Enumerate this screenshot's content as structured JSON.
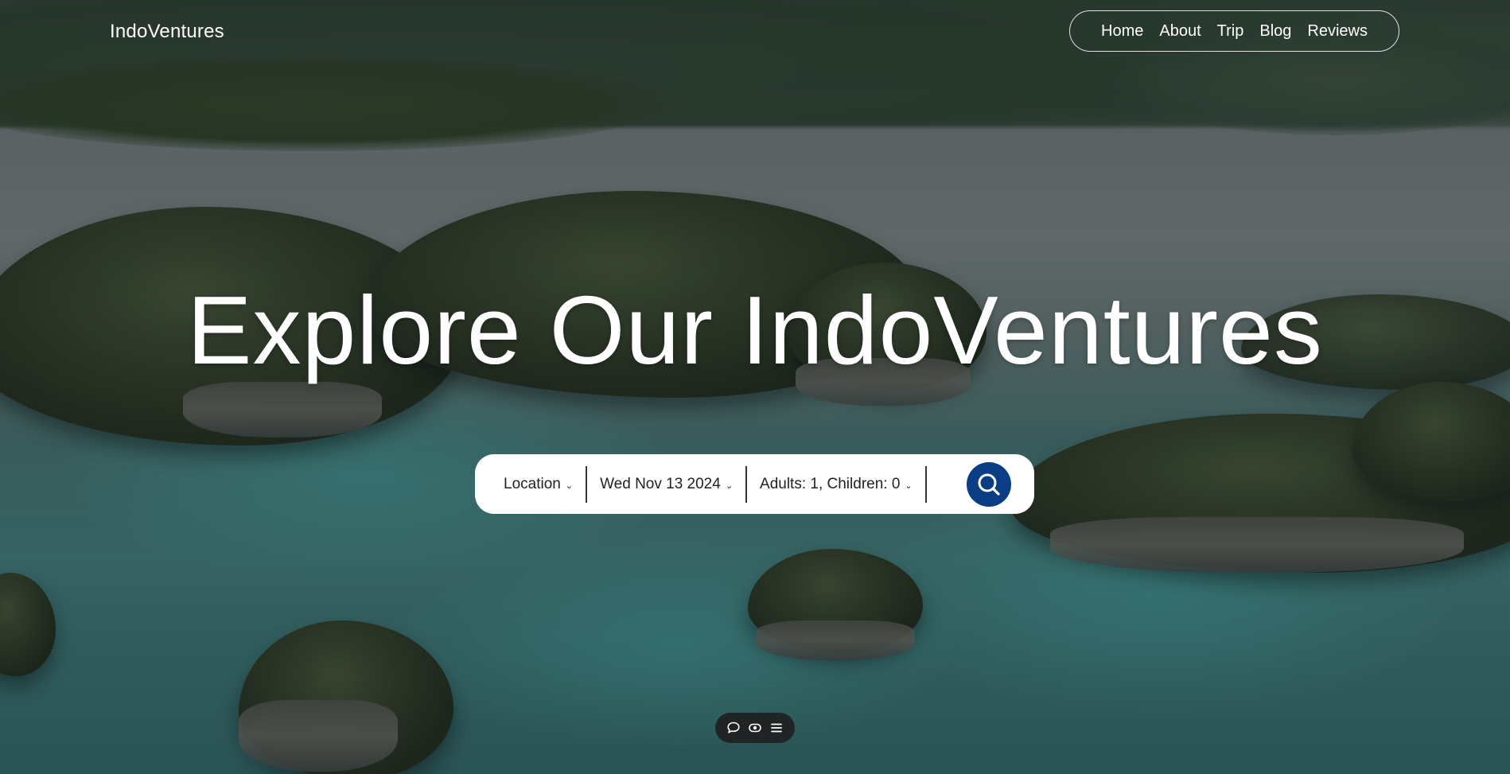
{
  "brand": "IndoVentures",
  "nav": {
    "items": [
      "Home",
      "About",
      "Trip",
      "Blog",
      "Reviews"
    ]
  },
  "hero": {
    "headline": "Explore Our IndoVentures"
  },
  "search": {
    "location": "Location",
    "date": "Wed Nov 13 2024",
    "guests": "Adults: 1, Children: 0",
    "button_icon": "search-icon",
    "button_color": "#0a3d84"
  },
  "toolbar": {
    "icons": [
      "comment-icon",
      "eye-toggle-icon",
      "menu-icon"
    ]
  }
}
